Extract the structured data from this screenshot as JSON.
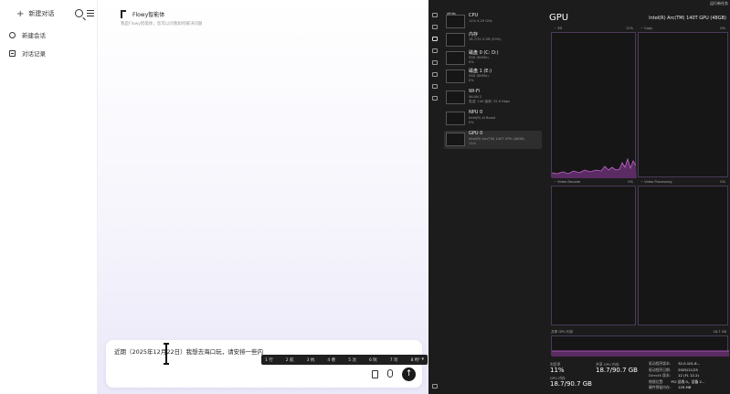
{
  "sidebar": {
    "new_chat_label": "新建对话",
    "items": [
      {
        "label": "新建会话"
      },
      {
        "label": "对话记录"
      }
    ]
  },
  "header": {
    "title": "Flowy智能体",
    "subtitle": "我是Flowy智能体，您可以问我如何解决问题"
  },
  "input": {
    "text": "近期（2025年12月22日）我想去海口玩，请安排一些内",
    "send_icon": "arrow-up-icon"
  },
  "ime": {
    "candidates": [
      "1 行",
      "2 航",
      "3 杭",
      "4 巷",
      "5 沆",
      "6 吭",
      "7 珩",
      "8 绗"
    ]
  },
  "task_manager": {
    "section_label": "性能",
    "run_task_label": "运行新任务",
    "resources": [
      {
        "name": "CPU",
        "sub": "11%  4.29 GHz",
        "sub2": ""
      },
      {
        "name": "内存",
        "sub": "18.7/31.5 GB (59%)",
        "sub2": ""
      },
      {
        "name": "磁盘 0 (C: D:)",
        "sub": "SSD (NVMe)",
        "sub2": "0%"
      },
      {
        "name": "磁盘 1 (E:)",
        "sub": "SSD (NVMe)",
        "sub2": "0%"
      },
      {
        "name": "Wi-Fi",
        "sub": "WLAN 2",
        "sub2": "发送: 144 接收: 32.0 Kbps"
      },
      {
        "name": "NPU 0",
        "sub": "Intel(R) AI Boost",
        "sub2": "0%"
      },
      {
        "name": "GPU 0",
        "sub": "Intel(R) Arc(TM) 140T GPU (48GB)",
        "sub2": "11%"
      }
    ],
    "gpu": {
      "title": "GPU",
      "model": "Intel(R) Arc(TM) 140T GPU (48GB)",
      "graphs": [
        {
          "label": "~ 3D",
          "right": "11%"
        },
        {
          "label": "~ Copy",
          "right": "0%"
        },
        {
          "label": "~ Video Decode",
          "right": "0%"
        },
        {
          "label": "~ Video Processing",
          "right": "0%"
        }
      ],
      "shared_memory_label": "共享 GPU 内存",
      "shared_memory_value": "18.7 GB",
      "stats": [
        {
          "label": "利用率",
          "value": "11%"
        },
        {
          "label": "共享 GPU 内存",
          "value": "18.7/90.7 GB"
        },
        {
          "label": "GPU 内存",
          "value": "18.7/90.7 GB"
        }
      ],
      "details": [
        {
          "label": "驱动程序版本:",
          "value": "32.0.101.6..."
        },
        {
          "label": "驱动程序日期:",
          "value": "2025/11/25"
        },
        {
          "label": "DirectX 版本:",
          "value": "12 (FL 12.2)"
        },
        {
          "label": "物理位置:",
          "value": "PCI 总线 0，设备 2..."
        },
        {
          "label": "硬件预留内存:",
          "value": "129 MB"
        }
      ]
    }
  },
  "colors": {
    "graph_line": "#c265ce",
    "graph_fill": "#5a2c63",
    "send_button": "#1a1a1a"
  }
}
